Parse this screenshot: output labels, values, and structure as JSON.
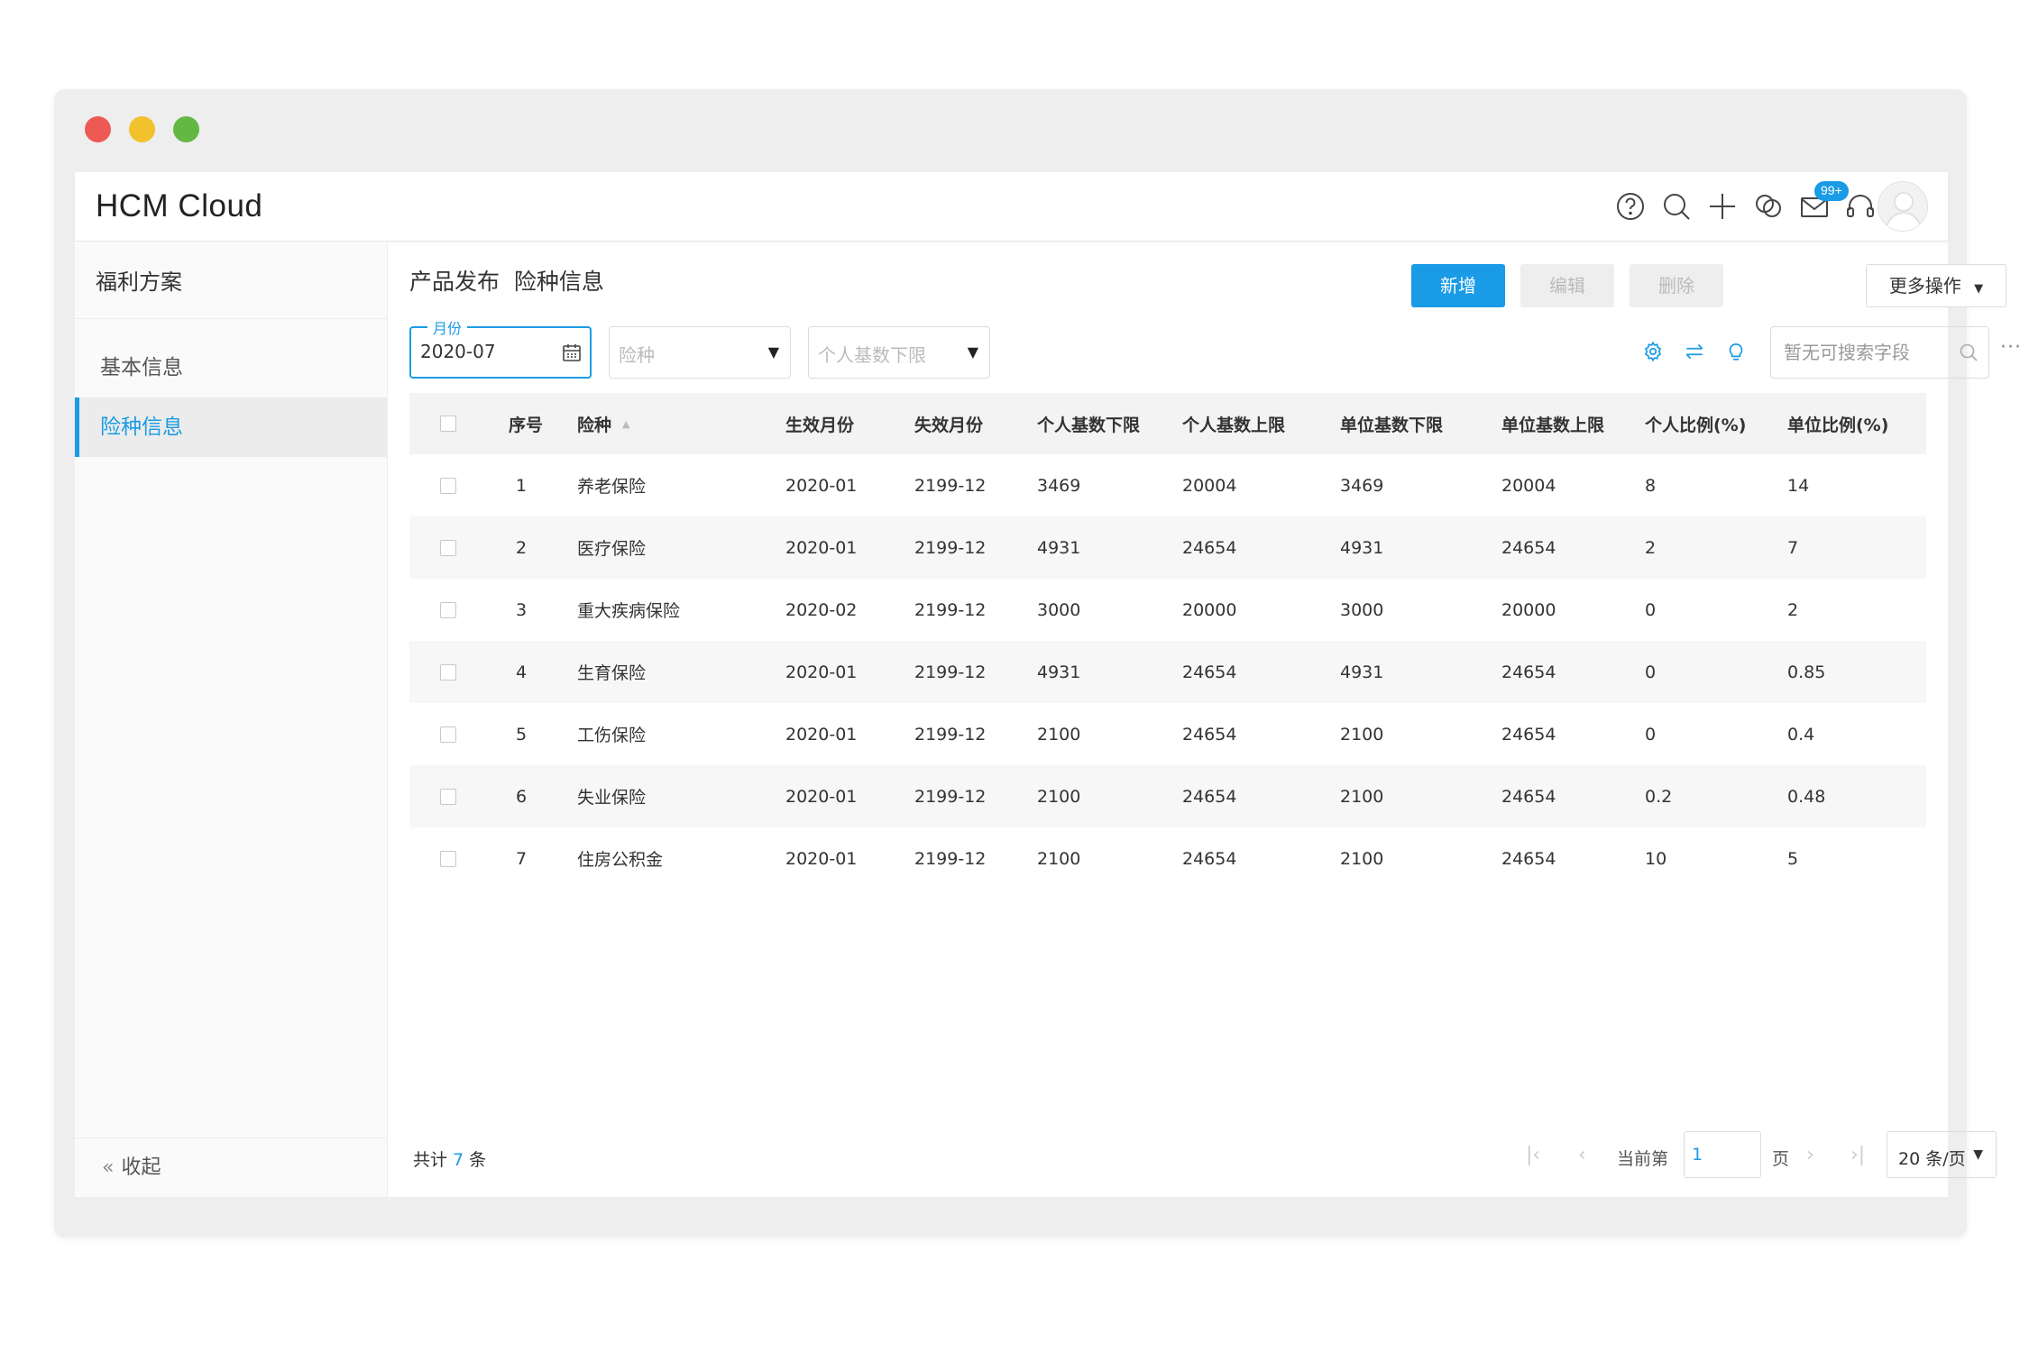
{
  "app": {
    "brand": "HCM Cloud",
    "mail_badge": "99+"
  },
  "top_icons": [
    "help-icon",
    "search-icon",
    "plus-icon",
    "chat-icon",
    "mail-icon",
    "headset-icon",
    "avatar"
  ],
  "sidebar": {
    "title": "福利方案",
    "items": [
      {
        "label": "基本信息",
        "active": false
      },
      {
        "label": "险种信息",
        "active": true
      }
    ],
    "collapse_label": "收起"
  },
  "main": {
    "title": "产品发布  险种信息",
    "buttons": {
      "add": "新增",
      "edit": "编辑",
      "delete": "删除",
      "more": "更多操作"
    },
    "filters": {
      "month_label": "月份",
      "month_value": "2020-07",
      "type_placeholder": "险种",
      "base_placeholder": "个人基数下限"
    },
    "search_placeholder": "暂无可搜索字段"
  },
  "table": {
    "headers": [
      "序号",
      "险种",
      "生效月份",
      "失效月份",
      "个人基数下限",
      "个人基数上限",
      "单位基数下限",
      "单位基数上限",
      "个人比例(%)",
      "单位比例(%)"
    ],
    "rows": [
      [
        "1",
        "养老保险",
        "2020-01",
        "2199-12",
        "3469",
        "20004",
        "3469",
        "20004",
        "8",
        "14"
      ],
      [
        "2",
        "医疗保险",
        "2020-01",
        "2199-12",
        "4931",
        "24654",
        "4931",
        "24654",
        "2",
        "7"
      ],
      [
        "3",
        "重大疾病保险",
        "2020-02",
        "2199-12",
        "3000",
        "20000",
        "3000",
        "20000",
        "0",
        "2"
      ],
      [
        "4",
        "生育保险",
        "2020-01",
        "2199-12",
        "4931",
        "24654",
        "4931",
        "24654",
        "0",
        "0.85"
      ],
      [
        "5",
        "工伤保险",
        "2020-01",
        "2199-12",
        "2100",
        "24654",
        "2100",
        "24654",
        "0",
        "0.4"
      ],
      [
        "6",
        "失业保险",
        "2020-01",
        "2199-12",
        "2100",
        "24654",
        "2100",
        "24654",
        "0.2",
        "0.48"
      ],
      [
        "7",
        "住房公积金",
        "2020-01",
        "2199-12",
        "2100",
        "24654",
        "2100",
        "24654",
        "10",
        "5"
      ]
    ]
  },
  "footer": {
    "total_prefix": "共计",
    "total_count": "7",
    "total_suffix": "条",
    "current_label": "当前第",
    "current_page": "1",
    "page_suffix": "页",
    "page_size": "20 条/页"
  },
  "colors": {
    "accent": "#1a9be6",
    "sidebar_bg": "#fafafa",
    "header_bg": "#f3f3f3"
  }
}
